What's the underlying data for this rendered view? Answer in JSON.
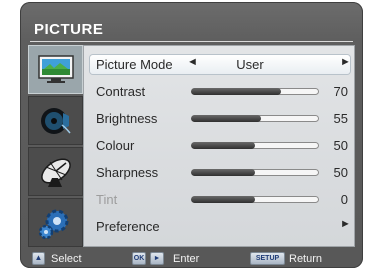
{
  "menu": {
    "title": "PICTURE",
    "tabs": [
      {
        "icon": "picture-icon",
        "active": true
      },
      {
        "icon": "audio-icon",
        "active": false
      },
      {
        "icon": "satellite-dish-icon",
        "active": false
      },
      {
        "icon": "settings-gear-icon",
        "active": false
      }
    ],
    "picture_mode": {
      "label": "Picture Mode",
      "left_arrow": "◄",
      "value": "User",
      "right_arrow": "►"
    },
    "settings": [
      {
        "key": "contrast",
        "label": "Contrast",
        "value": "70",
        "level": 0.7,
        "disabled": false
      },
      {
        "key": "brightness",
        "label": "Brightness",
        "value": "55",
        "level": 0.55,
        "disabled": false
      },
      {
        "key": "colour",
        "label": "Colour",
        "value": "50",
        "level": 0.5,
        "disabled": false
      },
      {
        "key": "sharpness",
        "label": "Sharpness",
        "value": "50",
        "level": 0.5,
        "disabled": false
      },
      {
        "key": "tint",
        "label": "Tint",
        "value": "0",
        "level": 0.5,
        "disabled": true
      }
    ],
    "preference": {
      "label": "Preference",
      "arrow": "►"
    }
  },
  "footer": {
    "select_label": "Select",
    "ok_key": "OK",
    "enter_key_arrow": "►",
    "enter_label": "Enter",
    "setup_key": "SETUP",
    "return_label": "Return"
  },
  "colors": {
    "osd_bg": "#5e5e5e",
    "panel_bg": "#d8dbde",
    "active_tab": "#9aa6ab",
    "disabled_text": "#9d9d9d"
  }
}
